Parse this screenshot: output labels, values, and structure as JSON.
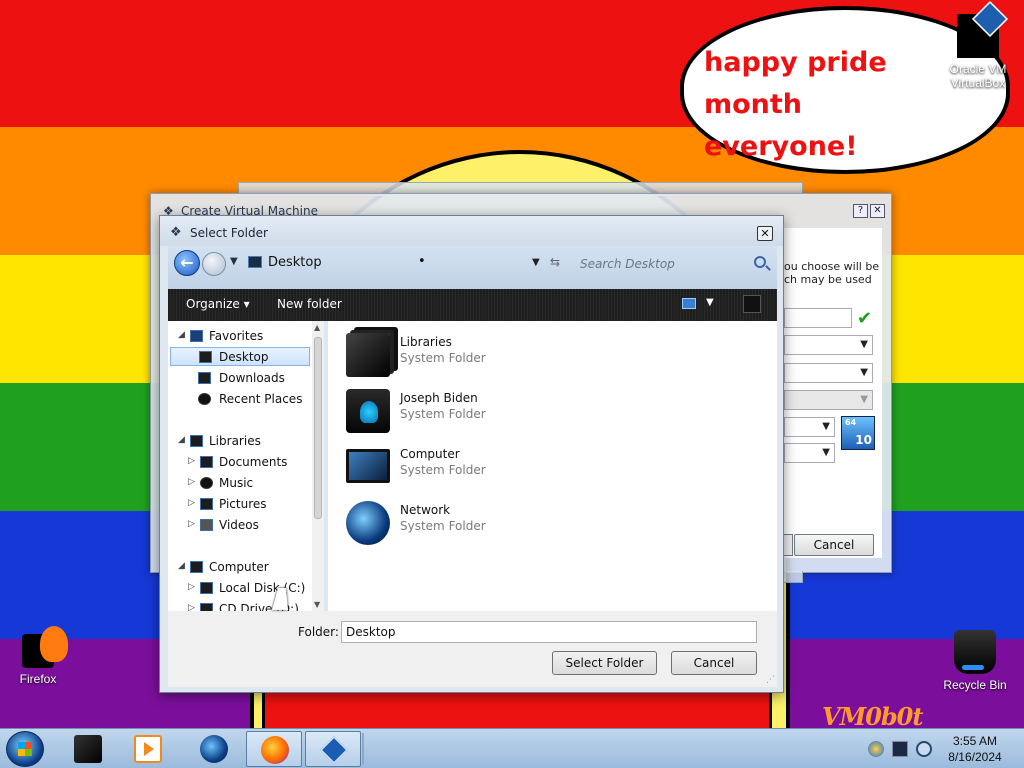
{
  "desktop": {
    "bubble_text": "happy pride month everyone!",
    "watermark": "VM0b0t",
    "icons": [
      {
        "label": "Oracle VM VirtualBox"
      },
      {
        "label": "Firefox"
      },
      {
        "label": "Recycle Bin"
      }
    ]
  },
  "back_dialog": {
    "title": "Create Virtual Machine",
    "hint": "ou choose will be ch may be used",
    "cancel_label": "Cancel",
    "os_badge_64": "64",
    "os_badge_ver": "10"
  },
  "dialog": {
    "title": "Select Folder",
    "address": "Desktop",
    "search_placeholder": "Search Desktop",
    "toolbar": {
      "organize": "Organize ▾",
      "new_folder": "New folder"
    },
    "tree": [
      {
        "label": "Favorites"
      },
      {
        "label": "Desktop"
      },
      {
        "label": "Downloads"
      },
      {
        "label": "Recent Places"
      },
      {
        "label": "Libraries"
      },
      {
        "label": "Documents"
      },
      {
        "label": "Music"
      },
      {
        "label": "Pictures"
      },
      {
        "label": "Videos"
      },
      {
        "label": "Computer"
      },
      {
        "label": "Local Disk (C:)"
      },
      {
        "label": "CD Drive (D:)"
      }
    ],
    "files": [
      {
        "name": "Libraries",
        "type": "System Folder"
      },
      {
        "name": "Joseph Biden",
        "type": "System Folder"
      },
      {
        "name": "Computer",
        "type": "System Folder"
      },
      {
        "name": "Network",
        "type": "System Folder"
      }
    ],
    "folder_label": "Folder:",
    "folder_value": "Desktop",
    "select_label": "Select Folder",
    "cancel_label": "Cancel"
  },
  "taskbar": {
    "time": "3:55 AM",
    "date": "8/16/2024"
  }
}
